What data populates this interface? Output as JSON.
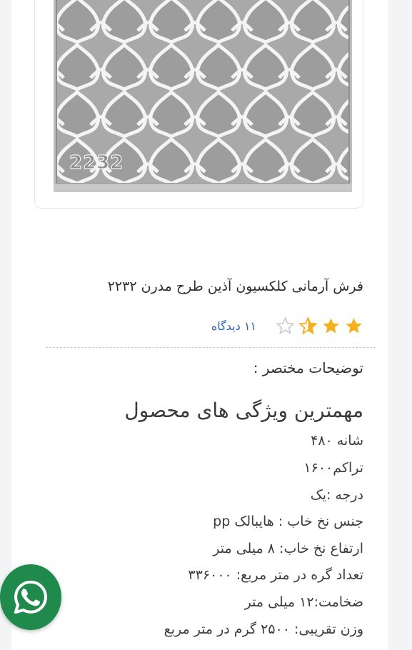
{
  "product": {
    "image_code": "2232",
    "title": "فرش آرمانی کلکسیون آذین طرح مدرن ۲۲۳۲",
    "rating": 2.5,
    "rating_max": 5,
    "views_label": "۱۱ دیدگاه"
  },
  "short_description": {
    "title": "توضیحات مختصر :"
  },
  "features": {
    "heading": "مهمترین ویژگی های محصول",
    "items": [
      "شانه ۴۸۰",
      "تراکم۱۶۰۰",
      "درجه :یک",
      "جنس نخ خاب : هایبالک pp",
      "ارتفاع نخ خاب: ۸ میلی متر",
      "تعداد گره در متر مربع: ۳۳۶۰۰۰",
      "ضخامت:۱۲ میلی متر",
      "وزن تقریبی: ۲۵۰۰ گرم در متر مربع"
    ]
  },
  "colors": {
    "star_filled": "#f6b01e",
    "star_empty": "#cfcfcf",
    "link": "#2e63b5",
    "whatsapp": "#1f8a4c"
  },
  "icons": {
    "whatsapp": "whatsapp-icon",
    "star": "star-icon"
  }
}
